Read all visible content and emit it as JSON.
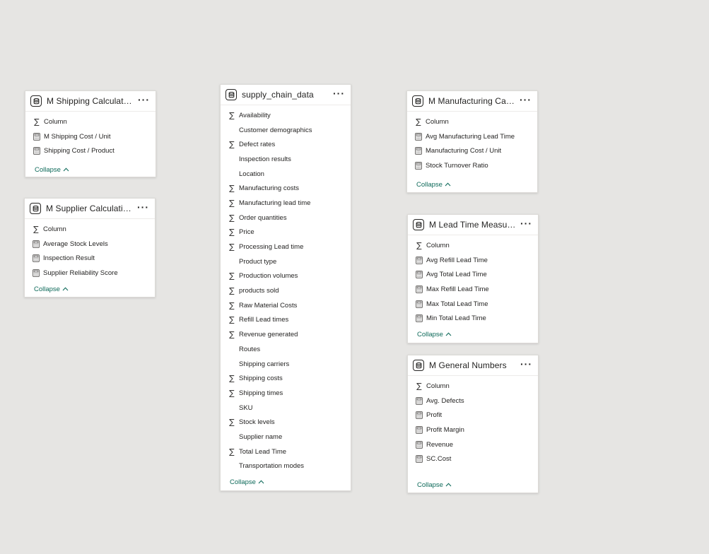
{
  "ui": {
    "collapse_label": "Collapse",
    "more_label": "···"
  },
  "tables": {
    "shipping": {
      "title": "M Shipping Calculations",
      "fields": [
        {
          "name": "Column",
          "icon": "sigma-icon"
        },
        {
          "name": "M Shipping Cost / Unit",
          "icon": "calculator-icon"
        },
        {
          "name": "Shipping Cost / Product",
          "icon": "calculator-icon"
        }
      ]
    },
    "supplier": {
      "title": "M Supplier Calculations",
      "fields": [
        {
          "name": "Column",
          "icon": "sigma-icon"
        },
        {
          "name": "Average Stock Levels",
          "icon": "calculator-icon"
        },
        {
          "name": "Inspection Result",
          "icon": "calculator-icon"
        },
        {
          "name": "Supplier Reliability Score",
          "icon": "calculator-icon"
        }
      ]
    },
    "supply_chain": {
      "title": "supply_chain_data",
      "fields": [
        {
          "name": "Availability",
          "icon": "sigma-icon"
        },
        {
          "name": "Customer demographics",
          "icon": "none"
        },
        {
          "name": "Defect rates",
          "icon": "sigma-icon"
        },
        {
          "name": "Inspection results",
          "icon": "none"
        },
        {
          "name": "Location",
          "icon": "none"
        },
        {
          "name": "Manufacturing costs",
          "icon": "sigma-icon"
        },
        {
          "name": "Manufacturing lead time",
          "icon": "sigma-icon"
        },
        {
          "name": "Order quantities",
          "icon": "sigma-icon"
        },
        {
          "name": "Price",
          "icon": "sigma-icon"
        },
        {
          "name": "Processing Lead time",
          "icon": "sigma-icon"
        },
        {
          "name": "Product type",
          "icon": "none"
        },
        {
          "name": "Production volumes",
          "icon": "sigma-icon"
        },
        {
          "name": "products sold",
          "icon": "sigma-icon"
        },
        {
          "name": "Raw Material Costs",
          "icon": "sigma-icon"
        },
        {
          "name": "Refill Lead times",
          "icon": "sigma-icon"
        },
        {
          "name": "Revenue generated",
          "icon": "sigma-icon"
        },
        {
          "name": "Routes",
          "icon": "none"
        },
        {
          "name": "Shipping carriers",
          "icon": "none"
        },
        {
          "name": "Shipping costs",
          "icon": "sigma-icon"
        },
        {
          "name": "Shipping times",
          "icon": "sigma-icon"
        },
        {
          "name": "SKU",
          "icon": "none"
        },
        {
          "name": "Stock levels",
          "icon": "sigma-icon"
        },
        {
          "name": "Supplier name",
          "icon": "none"
        },
        {
          "name": "Total Lead Time",
          "icon": "sigma-icon"
        },
        {
          "name": "Transportation modes",
          "icon": "none"
        }
      ]
    },
    "manufacturing": {
      "title": "M Manufacturing Calcu...",
      "fields": [
        {
          "name": "Column",
          "icon": "sigma-icon"
        },
        {
          "name": "Avg Manufacturing Lead Time",
          "icon": "calculator-icon"
        },
        {
          "name": "Manufacturing Cost / Unit",
          "icon": "calculator-icon"
        },
        {
          "name": "Stock Turnover Ratio",
          "icon": "calculator-icon"
        }
      ]
    },
    "lead_time": {
      "title": "M Lead Time Measures",
      "fields": [
        {
          "name": "Column",
          "icon": "sigma-icon"
        },
        {
          "name": "Avg Refill Lead Time",
          "icon": "calculator-icon"
        },
        {
          "name": "Avg Total Lead Time",
          "icon": "calculator-icon"
        },
        {
          "name": "Max Refill Lead Time",
          "icon": "calculator-icon"
        },
        {
          "name": "Max Total Lead Time",
          "icon": "calculator-icon"
        },
        {
          "name": "Min Total Lead Time",
          "icon": "calculator-icon"
        }
      ]
    },
    "general": {
      "title": "M General Numbers",
      "fields": [
        {
          "name": "Column",
          "icon": "sigma-icon"
        },
        {
          "name": "Avg. Defects",
          "icon": "calculator-icon"
        },
        {
          "name": "Profit",
          "icon": "calculator-icon"
        },
        {
          "name": "Profit Margin",
          "icon": "calculator-icon"
        },
        {
          "name": "Revenue",
          "icon": "calculator-icon"
        },
        {
          "name": "SC.Cost",
          "icon": "calculator-icon"
        }
      ]
    }
  }
}
